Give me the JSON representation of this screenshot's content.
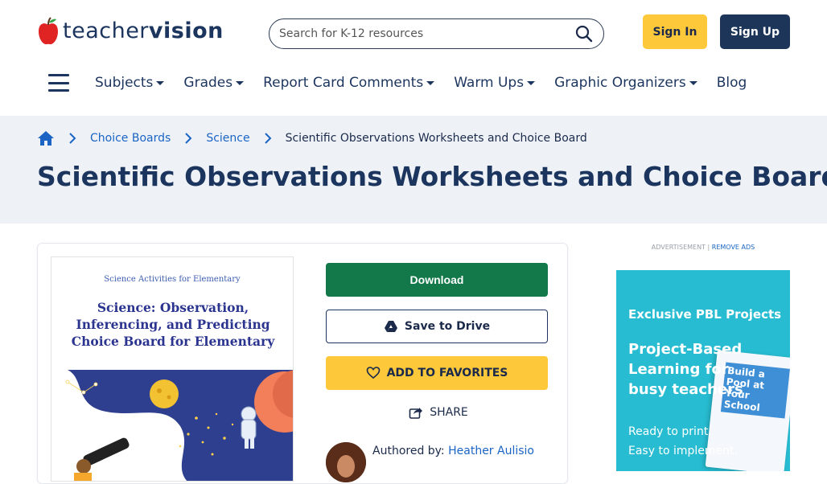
{
  "header": {
    "logo_part1": "teacher",
    "logo_part2": "vision",
    "search_placeholder": "Search for K-12 resources",
    "signin_label": "Sign In",
    "signup_label": "Sign Up"
  },
  "nav": {
    "items": [
      {
        "label": "Subjects",
        "dropdown": true
      },
      {
        "label": "Grades",
        "dropdown": true
      },
      {
        "label": "Report Card Comments",
        "dropdown": true
      },
      {
        "label": "Warm Ups",
        "dropdown": true
      },
      {
        "label": "Graphic Organizers",
        "dropdown": true
      },
      {
        "label": "Blog",
        "dropdown": false
      }
    ]
  },
  "breadcrumb": {
    "items": [
      "Choice Boards",
      "Science"
    ],
    "current": "Scientific Observations Worksheets and Choice Board"
  },
  "page": {
    "title": "Scientific Observations Worksheets and Choice Board"
  },
  "preview": {
    "subtitle": "Science Activities for Elementary",
    "title": "Science: Observation, Inferencing, and Predicting Choice Board for Elementary"
  },
  "actions": {
    "download_label": "Download",
    "drive_label": "Save to Drive",
    "favorites_label": "ADD TO FAVORITES",
    "share_label": "SHARE"
  },
  "author": {
    "prefix": "Authored by:",
    "name": "Heather Aulisio"
  },
  "ad": {
    "label": "ADVERTISEMENT |",
    "remove": "REMOVE ADS",
    "heading1": "Exclusive PBL Projects",
    "heading2": "Project-Based Learning for busy teachers",
    "line1": "Ready to print.",
    "line2": "Easy to implement.",
    "book_title": "Build a Pool at Your School"
  },
  "colors": {
    "brand_navy": "#1b355e",
    "accent_yellow": "#fdc93b",
    "download_green": "#13784a",
    "link_blue": "#1b64c4",
    "ad_teal": "#27bcd1"
  }
}
